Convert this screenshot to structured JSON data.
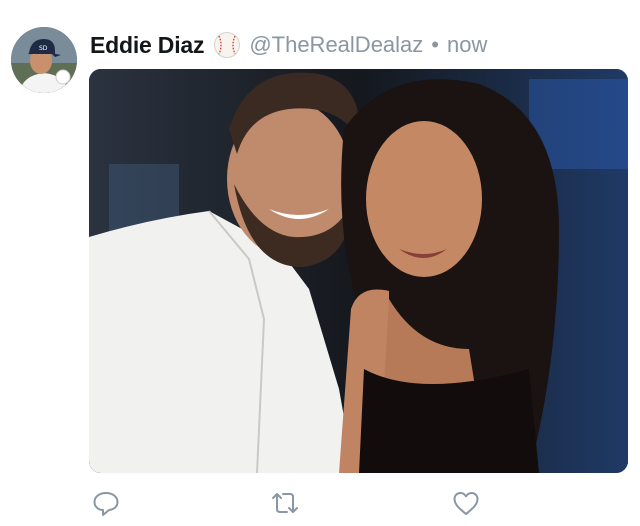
{
  "tweet": {
    "author": {
      "name": "Eddie Diaz",
      "badge_icon": "baseball-emoji",
      "handle": "@TheRealDealaz",
      "separator": "•",
      "timestamp": "now"
    },
    "avatar": {
      "kind": "profile-photo"
    },
    "media": {
      "kind": "photo"
    },
    "actions": [
      {
        "name": "reply",
        "icon": "speech-bubble-icon"
      },
      {
        "name": "retweet",
        "icon": "retweet-arrows-icon"
      },
      {
        "name": "like",
        "icon": "heart-icon"
      }
    ]
  },
  "colors": {
    "name_text": "#14171a",
    "meta_text": "#8a96a1",
    "icon_gray": "#8a96a1",
    "background": "#ffffff"
  }
}
